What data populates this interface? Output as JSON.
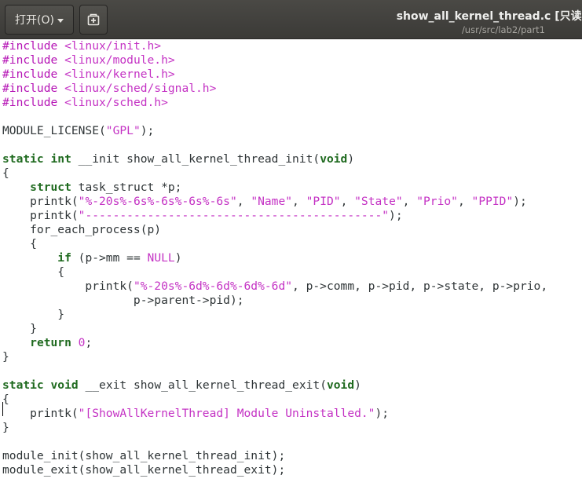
{
  "headerbar": {
    "open_label": "打开(O)",
    "open_dropdown_icon": "chevron-down-icon",
    "new_document_icon": "new-document-icon",
    "title": "show_all_kernel_thread.c [只读]",
    "subtitle": "/usr/src/lab2/part1"
  },
  "theme": {
    "headerbar_bg": "#3d3c38",
    "default_text": "#2e3436",
    "preprocessor": "#b514b5",
    "string": "#c432c4",
    "keyword": "#1f6a1f",
    "type": "#1f6a1f"
  },
  "editor": {
    "lines": [
      [
        {
          "t": "#include ",
          "c": "pp"
        },
        {
          "t": "<linux/init.h>",
          "c": "str"
        }
      ],
      [
        {
          "t": "#include ",
          "c": "pp"
        },
        {
          "t": "<linux/module.h>",
          "c": "str"
        }
      ],
      [
        {
          "t": "#include ",
          "c": "pp"
        },
        {
          "t": "<linux/kernel.h>",
          "c": "str"
        }
      ],
      [
        {
          "t": "#include ",
          "c": "pp"
        },
        {
          "t": "<linux/sched/signal.h>",
          "c": "str"
        }
      ],
      [
        {
          "t": "#include ",
          "c": "pp"
        },
        {
          "t": "<linux/sched.h>",
          "c": "str"
        }
      ],
      [],
      [
        {
          "t": "MODULE_LICENSE(",
          "c": ""
        },
        {
          "t": "\"GPL\"",
          "c": "str"
        },
        {
          "t": ");",
          "c": ""
        }
      ],
      [],
      [
        {
          "t": "static",
          "c": "kw"
        },
        {
          "t": " ",
          "c": ""
        },
        {
          "t": "int",
          "c": "kw"
        },
        {
          "t": " __init show_all_kernel_thread_init(",
          "c": ""
        },
        {
          "t": "void",
          "c": "kw"
        },
        {
          "t": ")",
          "c": ""
        }
      ],
      [
        {
          "t": "{",
          "c": ""
        }
      ],
      [
        {
          "t": "    ",
          "c": ""
        },
        {
          "t": "struct",
          "c": "kw"
        },
        {
          "t": " task_struct *p;",
          "c": ""
        }
      ],
      [
        {
          "t": "    printk(",
          "c": ""
        },
        {
          "t": "\"%-20s%-6s%-6s%-6s%-6s\"",
          "c": "str"
        },
        {
          "t": ", ",
          "c": ""
        },
        {
          "t": "\"Name\"",
          "c": "str"
        },
        {
          "t": ", ",
          "c": ""
        },
        {
          "t": "\"PID\"",
          "c": "str"
        },
        {
          "t": ", ",
          "c": ""
        },
        {
          "t": "\"State\"",
          "c": "str"
        },
        {
          "t": ", ",
          "c": ""
        },
        {
          "t": "\"Prio\"",
          "c": "str"
        },
        {
          "t": ", ",
          "c": ""
        },
        {
          "t": "\"PPID\"",
          "c": "str"
        },
        {
          "t": ");",
          "c": ""
        }
      ],
      [
        {
          "t": "    printk(",
          "c": ""
        },
        {
          "t": "\"-------------------------------------------\"",
          "c": "str"
        },
        {
          "t": ");",
          "c": ""
        }
      ],
      [
        {
          "t": "    for_each_process(p)",
          "c": ""
        }
      ],
      [
        {
          "t": "    {",
          "c": ""
        }
      ],
      [
        {
          "t": "        ",
          "c": ""
        },
        {
          "t": "if",
          "c": "kw"
        },
        {
          "t": " (p->mm == ",
          "c": ""
        },
        {
          "t": "NULL",
          "c": "str"
        },
        {
          "t": ")",
          "c": ""
        }
      ],
      [
        {
          "t": "        {",
          "c": ""
        }
      ],
      [
        {
          "t": "            printk(",
          "c": ""
        },
        {
          "t": "\"%-20s%-6d%-6d%-6d%-6d\"",
          "c": "str"
        },
        {
          "t": ", p->comm, p->pid, p->state, p->prio,",
          "c": ""
        }
      ],
      [
        {
          "t": "                   p->parent->pid);",
          "c": ""
        }
      ],
      [
        {
          "t": "        }",
          "c": ""
        }
      ],
      [
        {
          "t": "    }",
          "c": ""
        }
      ],
      [
        {
          "t": "    ",
          "c": ""
        },
        {
          "t": "return",
          "c": "kw"
        },
        {
          "t": " ",
          "c": ""
        },
        {
          "t": "0",
          "c": "str"
        },
        {
          "t": ";",
          "c": ""
        }
      ],
      [
        {
          "t": "}",
          "c": ""
        }
      ],
      [],
      [
        {
          "t": "static",
          "c": "kw"
        },
        {
          "t": " ",
          "c": ""
        },
        {
          "t": "void",
          "c": "kw"
        },
        {
          "t": " __exit show_all_kernel_thread_exit(",
          "c": ""
        },
        {
          "t": "void",
          "c": "kw"
        },
        {
          "t": ")",
          "c": ""
        }
      ],
      [
        {
          "t": "{",
          "c": ""
        }
      ],
      [
        {
          "t": "    printk(",
          "c": ""
        },
        {
          "t": "\"[ShowAllKernelThread] Module Uninstalled.\"",
          "c": "str"
        },
        {
          "t": ");",
          "c": ""
        }
      ],
      [
        {
          "t": "}",
          "c": ""
        }
      ],
      [],
      [
        {
          "t": "module_init(show_all_kernel_thread_init);",
          "c": ""
        }
      ],
      [
        {
          "t": "module_exit(show_all_kernel_thread_exit);",
          "c": ""
        }
      ]
    ]
  }
}
